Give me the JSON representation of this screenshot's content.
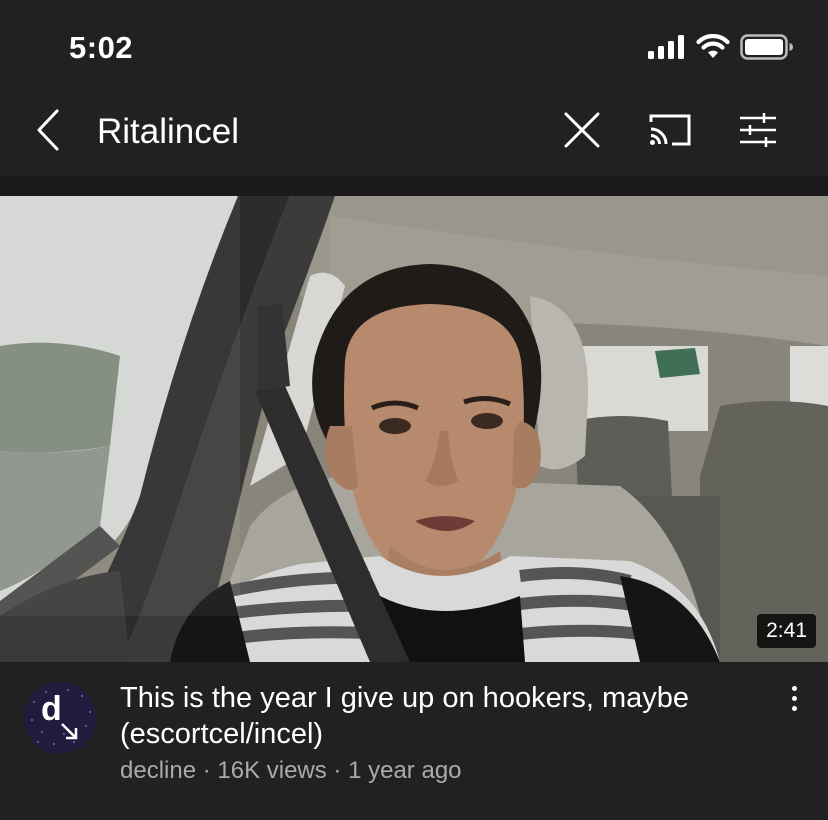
{
  "status_bar": {
    "time": "5:02",
    "icons": [
      "cellular-signal-icon",
      "wifi-icon",
      "battery-icon"
    ]
  },
  "search_bar": {
    "query": "Ritalincel",
    "icons": [
      "back-icon",
      "close-icon",
      "cast-icon",
      "filter-icon"
    ]
  },
  "video": {
    "duration": "2:41",
    "title": "This is the year I give up on hookers, maybe (escortcel/incel)",
    "meta": "decline · 16K views · 1 year ago",
    "channel_avatar_letter": "d",
    "menu_icon": "more-vertical-icon"
  },
  "colors": {
    "background": "#212121",
    "text_primary": "#ffffff",
    "text_secondary": "#aaaaaa"
  }
}
